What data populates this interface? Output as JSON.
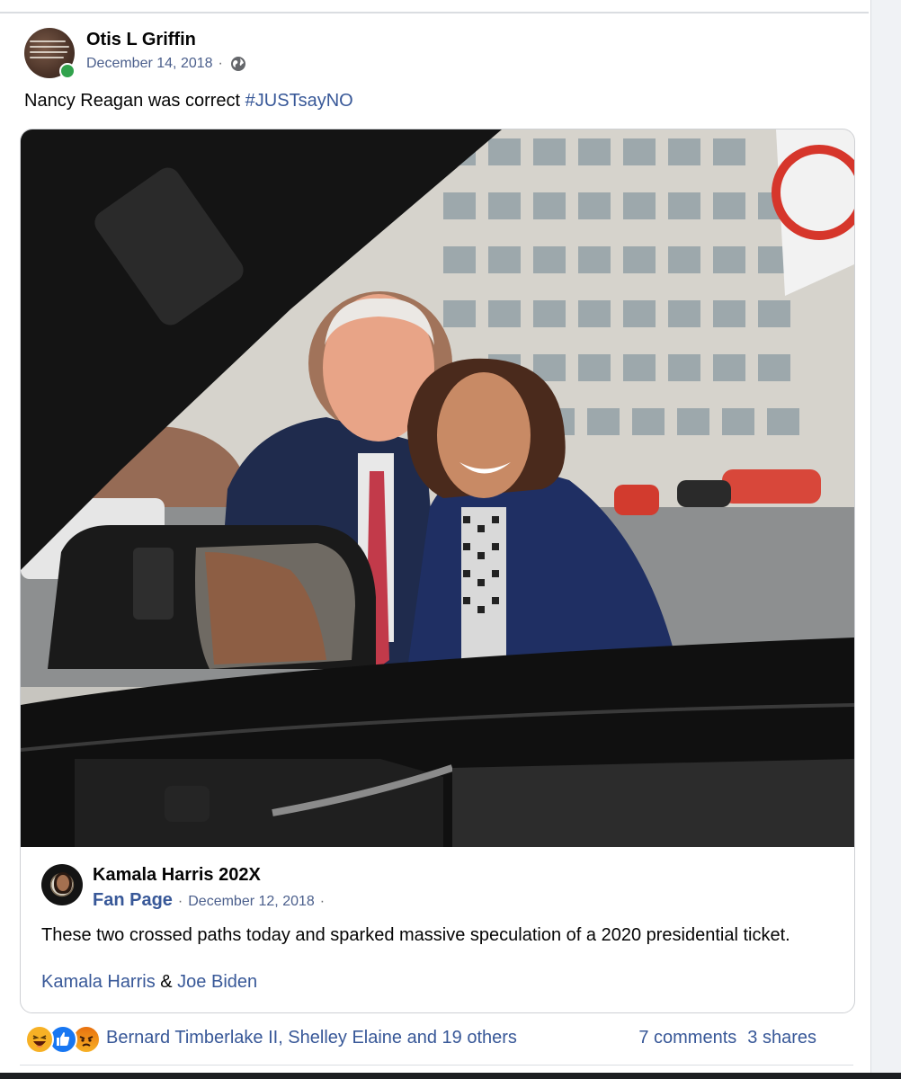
{
  "post": {
    "author": "Otis L Griffin",
    "date": "December 14, 2018",
    "dot": "·",
    "privacy_icon": "globe-icon",
    "text_prefix": "Nancy Reagan was correct ",
    "hashtag": "#JUSTsayNO"
  },
  "shared": {
    "page_name": "Kamala Harris 202X",
    "page_category": "Fan Page",
    "dot": "·",
    "date": "December 12, 2018",
    "text": "These two crossed paths today and sparked massive speculation of a 2020 presidential ticket.",
    "tag1": "Kamala Harris",
    "amp": "&",
    "tag2": "Joe Biden"
  },
  "footer": {
    "reaction_icons": [
      "haha-icon",
      "like-icon",
      "angry-icon"
    ],
    "reactors": "Bernard Timberlake II, Shelley Elaine and 19 others",
    "comments": "7 comments",
    "shares": "3 shares"
  },
  "colors": {
    "link": "#385898",
    "secondary": "#65676b",
    "presence": "#31a24c"
  }
}
